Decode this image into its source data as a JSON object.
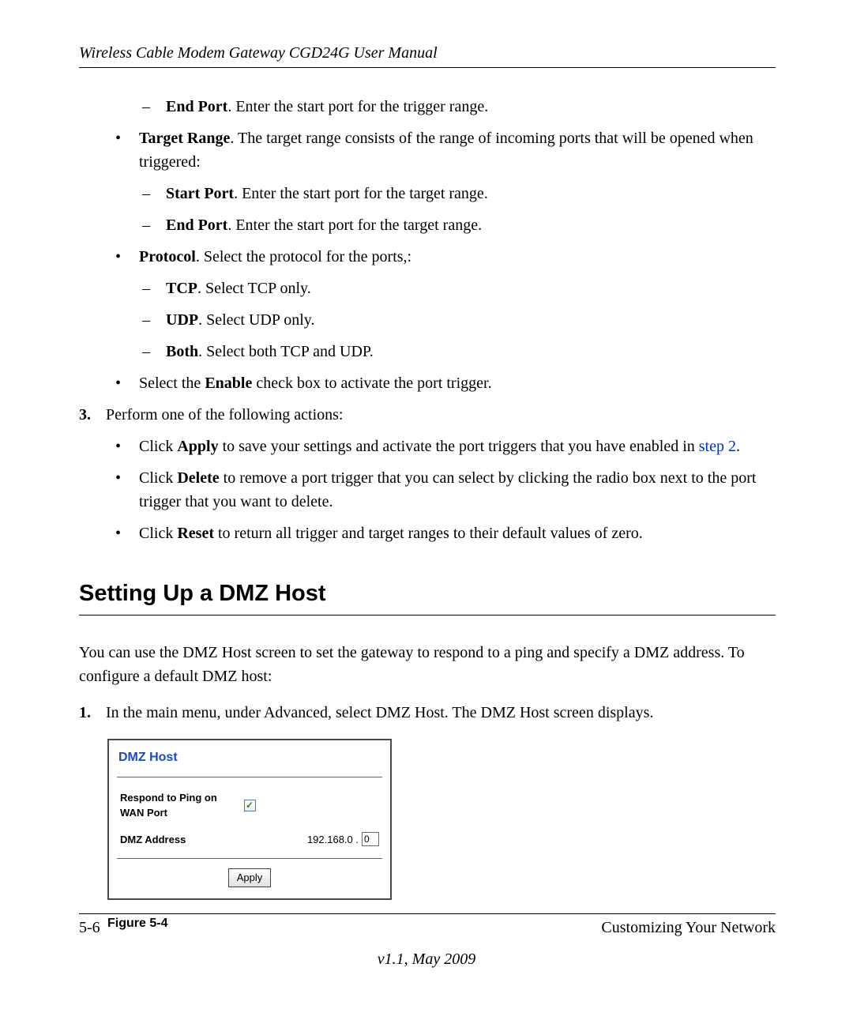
{
  "header": "Wireless Cable Modem Gateway CGD24G User Manual",
  "items": {
    "endport_trigger_label": "End Port",
    "endport_trigger_text": ". Enter the start port for the trigger range.",
    "target_range_label": "Target Range",
    "target_range_text": ". The target range consists of the range of incoming ports that will be opened when triggered:",
    "start_port_label": "Start Port",
    "start_port_text": ". Enter the start port for the target range.",
    "end_port_target_label": "End Port",
    "end_port_target_text": ". Enter the start port for the target range.",
    "protocol_label": "Protocol",
    "protocol_text": ". Select the protocol for the ports,:",
    "tcp_label": "TCP",
    "tcp_text": ". Select TCP only.",
    "udp_label": "UDP",
    "udp_text": ". Select UDP only.",
    "both_label": "Both",
    "both_text": ". Select both TCP and UDP.",
    "enable_prefix": "Select the ",
    "enable_bold": "Enable",
    "enable_suffix": " check box to activate the port trigger.",
    "step3_num": "3.",
    "step3_text": "Perform one of the following actions:",
    "apply_prefix": "Click ",
    "apply_bold": "Apply",
    "apply_mid": " to save your settings and activate the port triggers that you have enabled in ",
    "apply_link": "step 2",
    "apply_suffix": ".",
    "delete_prefix": "Click ",
    "delete_bold": "Delete",
    "delete_suffix": " to remove a port trigger that you can select by clicking the radio box next to the port trigger that you want to delete.",
    "reset_prefix": "Click ",
    "reset_bold": "Reset",
    "reset_suffix": " to return all trigger and target ranges to their default values of zero."
  },
  "section_heading": "Setting Up a DMZ Host",
  "intro_para": "You can use the DMZ Host screen to set the gateway to respond to a ping and specify a DMZ address. To configure a default DMZ host:",
  "step1": {
    "num": "1.",
    "text": "In the main menu, under Advanced, select DMZ Host. The DMZ Host screen displays."
  },
  "screenshot": {
    "title": "DMZ Host",
    "respond_label": "Respond to Ping on WAN Port",
    "respond_checked": "✓",
    "dmz_label": "DMZ Address",
    "ip_prefix": "192.168.0 .",
    "ip_value": "0",
    "apply_label": "Apply"
  },
  "figure_caption": "Figure 5-4",
  "footer": {
    "page_number": "5-6",
    "chapter": "Customizing Your Network",
    "version": "v1.1, May 2009"
  }
}
